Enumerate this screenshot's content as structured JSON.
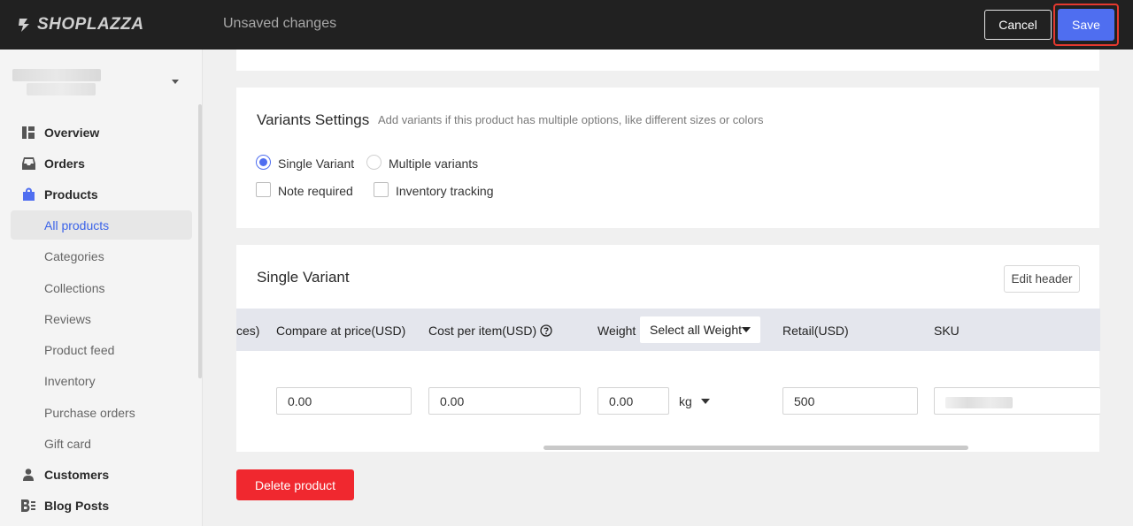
{
  "header": {
    "brand": "SHOPLAZZA",
    "status": "Unsaved changes",
    "cancel_label": "Cancel",
    "save_label": "Save"
  },
  "sidebar": {
    "items": [
      {
        "label": "Overview",
        "icon": "dashboard-icon"
      },
      {
        "label": "Orders",
        "icon": "inbox-icon"
      },
      {
        "label": "Products",
        "icon": "shopping-bag-icon"
      },
      {
        "label": "All products"
      },
      {
        "label": "Categories"
      },
      {
        "label": "Collections"
      },
      {
        "label": "Reviews"
      },
      {
        "label": "Product feed"
      },
      {
        "label": "Inventory"
      },
      {
        "label": "Purchase orders"
      },
      {
        "label": "Gift card"
      },
      {
        "label": "Customers",
        "icon": "user-icon"
      },
      {
        "label": "Blog Posts",
        "icon": "blog-icon"
      }
    ],
    "active": "All products"
  },
  "variants_settings": {
    "title": "Variants Settings",
    "description": "Add variants if this product has multiple options, like different sizes or colors",
    "single_variant_label": "Single Variant",
    "multiple_variants_label": "Multiple variants",
    "selected": "Single Variant",
    "note_required_label": "Note required",
    "inventory_tracking_label": "Inventory tracking"
  },
  "single_variant": {
    "title": "Single Variant",
    "edit_header_label": "Edit header",
    "columns": {
      "prices_partial": "ces)",
      "compare_at_price": "Compare at price(USD)",
      "cost_per_item": "Cost per item(USD)",
      "weight": "Weight",
      "weight_select": "Select all Weight",
      "retail": "Retail(USD)",
      "sku": "SKU"
    },
    "row": {
      "compare_at_price": "0.00",
      "cost_per_item": "0.00",
      "weight": "0.00",
      "weight_unit": "kg",
      "retail": "500"
    }
  },
  "delete_label": "Delete product",
  "colors": {
    "accent": "#4f6ef0",
    "danger": "#f0282f",
    "topbar": "#212121"
  }
}
